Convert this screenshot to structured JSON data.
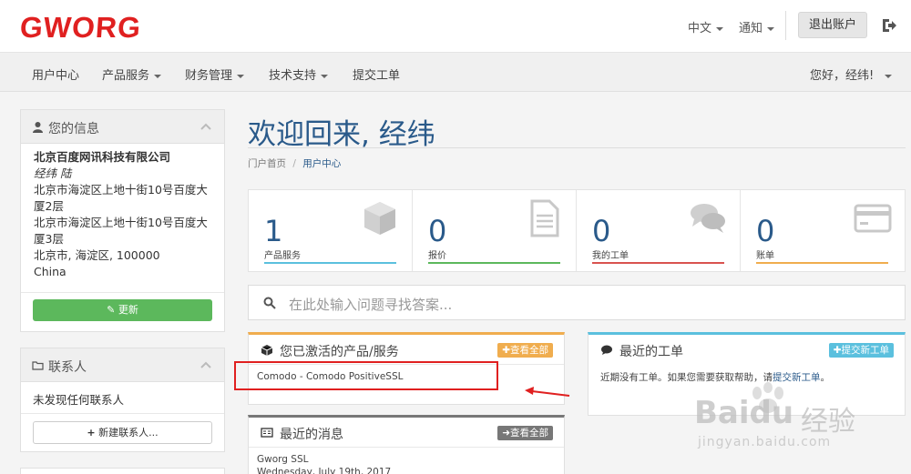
{
  "header": {
    "logo": "GWORG",
    "lang": "中文",
    "notify": "通知",
    "logout": "退出账户"
  },
  "nav": {
    "items": [
      "用户中心",
      "产品服务",
      "财务管理",
      "技术支持",
      "提交工单"
    ],
    "greeting": "您好，经纬!"
  },
  "sidebar": {
    "info": {
      "title": "您的信息",
      "company": "北京百度网讯科技有限公司",
      "person": "经纬 陆",
      "address1a": "北京市海淀区上地十街10号百度大",
      "address1b": "厦2层",
      "address2a": "北京市海淀区上地十街10号百度大",
      "address2b": "厦3层",
      "city": "北京市, 海淀区, 100000",
      "country": "China",
      "update_btn": "更新"
    },
    "contacts": {
      "title": "联系人",
      "empty": "未发现任何联系人",
      "new_btn": "新建联系人..."
    }
  },
  "main": {
    "title": "欢迎回来, 经纬",
    "breadcrumb_home": "门户首页",
    "breadcrumb_sep": "/",
    "breadcrumb_current": "用户中心",
    "stats": [
      {
        "value": "1",
        "label": "产品服务",
        "color": "#5bc0de",
        "icon": "cube-icon"
      },
      {
        "value": "0",
        "label": "报价",
        "color": "#5cb85c",
        "icon": "document-icon"
      },
      {
        "value": "0",
        "label": "我的工单",
        "color": "#d9534f",
        "icon": "comments-icon"
      },
      {
        "value": "0",
        "label": "账单",
        "color": "#f0ad4e",
        "icon": "credit-card-icon"
      }
    ],
    "search_placeholder": "在此处输入问题寻找答案...",
    "products": {
      "title": "您已激活的产品/服务",
      "view_all": "查看全部",
      "item": "Comodo - Comodo PositiveSSL"
    },
    "tickets": {
      "title": "最近的工单",
      "new_btn": "提交新工单",
      "text": "近期没有工单。如果您需要获取帮助，请",
      "link": "提交新工单",
      "end": "。"
    },
    "news": {
      "title": "最近的消息",
      "view_all": "查看全部",
      "item_title": "Gworg SSL",
      "item_date": "Wednesday, July 19th, 2017"
    }
  },
  "watermark": {
    "brand": "Bai",
    "brand2": "du",
    "cn": "经验",
    "url": "jingyan.baidu.com"
  },
  "colors": {
    "accent": "#2a5a8a",
    "logo": "#e02020",
    "green": "#5cb85c",
    "orange": "#f0ad4e",
    "info": "#5bc0de",
    "gray": "#777777"
  }
}
